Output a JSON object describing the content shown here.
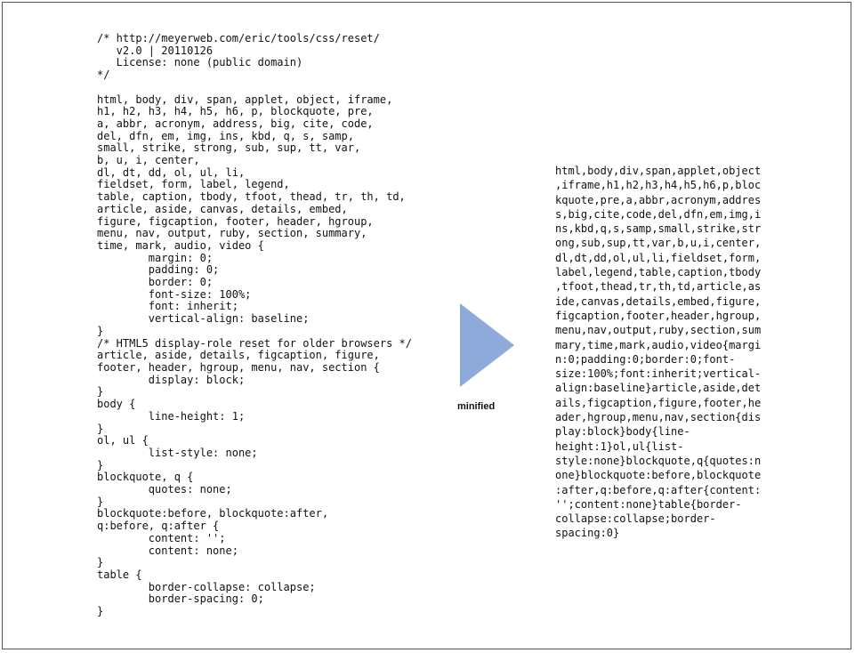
{
  "original_css": "/* http://meyerweb.com/eric/tools/css/reset/\n   v2.0 | 20110126\n   License: none (public domain)\n*/\n\nhtml, body, div, span, applet, object, iframe,\nh1, h2, h3, h4, h5, h6, p, blockquote, pre,\na, abbr, acronym, address, big, cite, code,\ndel, dfn, em, img, ins, kbd, q, s, samp,\nsmall, strike, strong, sub, sup, tt, var,\nb, u, i, center,\ndl, dt, dd, ol, ul, li,\nfieldset, form, label, legend,\ntable, caption, tbody, tfoot, thead, tr, th, td,\narticle, aside, canvas, details, embed,\nfigure, figcaption, footer, header, hgroup,\nmenu, nav, output, ruby, section, summary,\ntime, mark, audio, video {\n        margin: 0;\n        padding: 0;\n        border: 0;\n        font-size: 100%;\n        font: inherit;\n        vertical-align: baseline;\n}\n/* HTML5 display-role reset for older browsers */\narticle, aside, details, figcaption, figure,\nfooter, header, hgroup, menu, nav, section {\n        display: block;\n}\nbody {\n        line-height: 1;\n}\nol, ul {\n        list-style: none;\n}\nblockquote, q {\n        quotes: none;\n}\nblockquote:before, blockquote:after,\nq:before, q:after {\n        content: '';\n        content: none;\n}\ntable {\n        border-collapse: collapse;\n        border-spacing: 0;\n}",
  "arrow_label": "minified",
  "arrow_color": "#8eaadb",
  "minified_css": "html,body,div,span,applet,object\n,iframe,h1,h2,h3,h4,h5,h6,p,bloc\nkquote,pre,a,abbr,acronym,addres\ns,big,cite,code,del,dfn,em,img,i\nns,kbd,q,s,samp,small,strike,str\nong,sub,sup,tt,var,b,u,i,center,\ndl,dt,dd,ol,ul,li,fieldset,form,\nlabel,legend,table,caption,tbody\n,tfoot,thead,tr,th,td,article,as\nide,canvas,details,embed,figure,\nfigcaption,footer,header,hgroup,\nmenu,nav,output,ruby,section,sum\nmary,time,mark,audio,video{margi\nn:0;padding:0;border:0;font-\nsize:100%;font:inherit;vertical-\nalign:baseline}article,aside,det\nails,figcaption,figure,footer,he\nader,hgroup,menu,nav,section{dis\nplay:block}body{line-\nheight:1}ol,ul{list-\nstyle:none}blockquote,q{quotes:n\none}blockquote:before,blockquote\n:after,q:before,q:after{content:\n'';content:none}table{border-\ncollapse:collapse;border-\nspacing:0}"
}
